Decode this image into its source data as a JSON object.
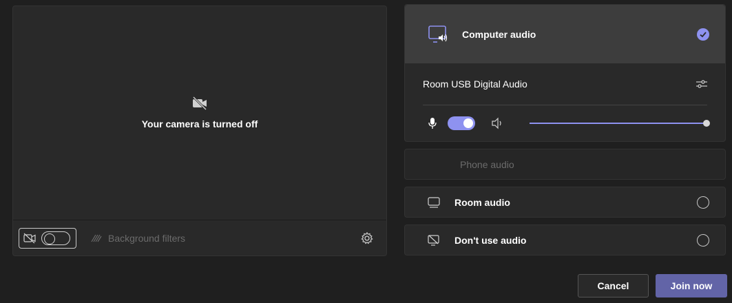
{
  "camera": {
    "status_text": "Your camera is turned off",
    "background_filters_label": "Background filters"
  },
  "audio": {
    "computer_audio_label": "Computer audio",
    "device_name": "Room USB Digital Audio",
    "mic_on": true,
    "volume": 1.0,
    "phone_audio_label": "Phone audio",
    "room_audio_label": "Room audio",
    "no_audio_label": "Don't use audio"
  },
  "actions": {
    "cancel_label": "Cancel",
    "join_label": "Join now"
  },
  "colors": {
    "accent": "#8e92f0",
    "primary_button": "#6264a7"
  }
}
